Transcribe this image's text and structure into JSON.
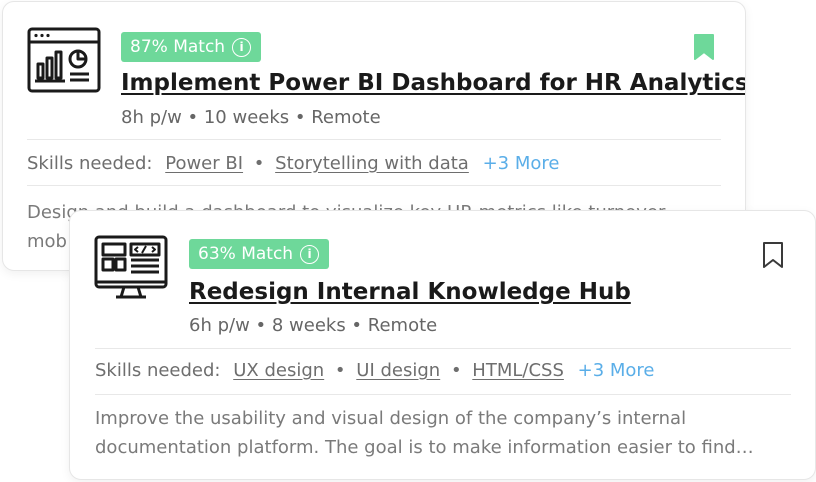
{
  "cards": [
    {
      "icon": "analytics-dashboard-icon",
      "match": "87% Match",
      "title": "Implement Power BI Dashboard for HR Analytics",
      "meta": "8h p/w • 10 weeks • Remote",
      "skills_label": "Skills needed:",
      "skills": [
        "Power BI",
        "Storytelling with data"
      ],
      "skills_sep": "•",
      "more": "+3 More",
      "bookmarked": true,
      "description": [
        "Design and build a dashboard to visualize key HR metrics like turnover,",
        "mob"
      ]
    },
    {
      "icon": "web-code-icon",
      "match": "63% Match",
      "title": "Redesign Internal Knowledge Hub",
      "meta": "6h p/w • 8 weeks • Remote",
      "skills_label": "Skills needed:",
      "skills": [
        "UX design",
        "UI design",
        "HTML/CSS"
      ],
      "skills_sep": "•",
      "more": "+3 More",
      "bookmarked": false,
      "description": [
        "Improve the usability and visual design of the company’s internal",
        "documentation platform. The goal is to make information easier to find…"
      ]
    }
  ],
  "colors": {
    "badge": "#6ed89a",
    "bookmark_active": "#6ed89a",
    "more_link": "#5aaee8",
    "title": "#1a1a1a"
  }
}
